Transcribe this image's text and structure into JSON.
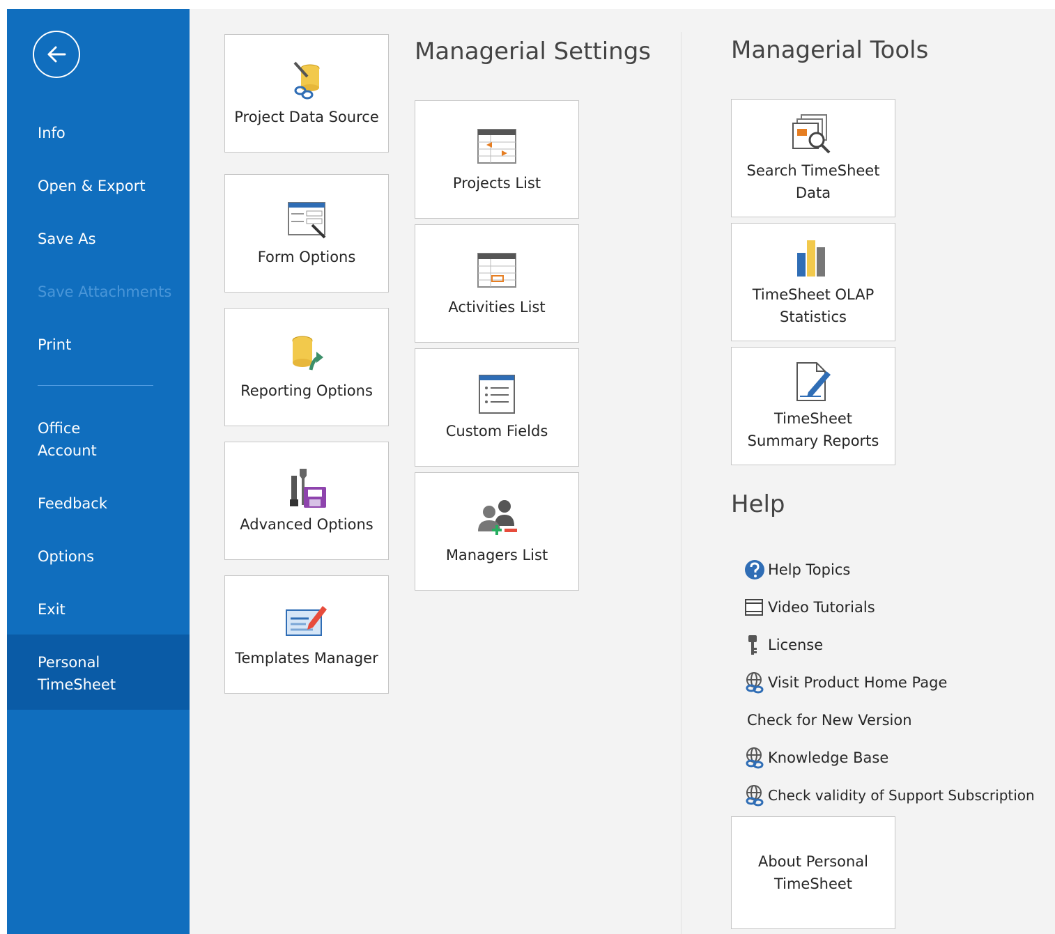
{
  "sidebar": {
    "items": [
      {
        "label": "Info"
      },
      {
        "label": "Open & Export"
      },
      {
        "label": "Save As"
      },
      {
        "label": "Save Attachments"
      },
      {
        "label": "Print"
      },
      {
        "label": "Office\nAccount"
      },
      {
        "label": "Feedback"
      },
      {
        "label": "Options"
      },
      {
        "label": "Exit"
      },
      {
        "label": "Personal\nTimeSheet"
      }
    ]
  },
  "tiles": {
    "project_data_source": "Project Data Source",
    "form_options": "Form Options",
    "reporting_options": "Reporting Options",
    "advanced_options": "Advanced Options",
    "templates_manager": "Templates Manager",
    "projects_list": "Projects List",
    "activities_list": "Activities List",
    "custom_fields": "Custom Fields",
    "managers_list": "Managers List",
    "search_timesheet_data": "Search TimeSheet Data",
    "olap_statistics": "TimeSheet OLAP Statistics",
    "summary_reports": "TimeSheet Summary Reports",
    "about": "About Personal TimeSheet"
  },
  "sections": {
    "managerial_settings": "Managerial Settings",
    "managerial_tools": "Managerial Tools",
    "help": "Help"
  },
  "help": {
    "items": [
      {
        "label": "Help Topics",
        "icon": "question-icon"
      },
      {
        "label": "Video Tutorials",
        "icon": "film-icon"
      },
      {
        "label": "License",
        "icon": "key-icon"
      },
      {
        "label": "Visit Product Home Page",
        "icon": "globe-link-icon"
      },
      {
        "label": "Check for New Version",
        "icon": ""
      },
      {
        "label": "Knowledge Base",
        "icon": "globe-link-icon"
      },
      {
        "label": "Check validity of Support Subscription",
        "icon": "globe-link-icon"
      }
    ]
  },
  "colors": {
    "sidebar": "#106ebe",
    "sidebar_active": "#0a5ba6",
    "content_bg": "#f3f3f3"
  }
}
